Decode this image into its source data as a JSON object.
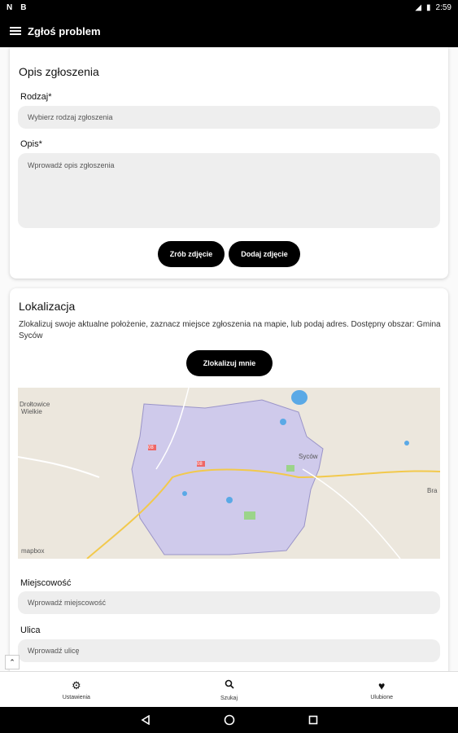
{
  "status_bar": {
    "left_icons": [
      "N",
      "B"
    ],
    "time": "2:59"
  },
  "app_bar": {
    "title": "Zgłoś problem"
  },
  "opis": {
    "title": "Opis zgłoszenia",
    "rodzaj_label": "Rodzaj*",
    "rodzaj_placeholder": "Wybierz rodzaj zgłoszenia",
    "opis_label": "Opis*",
    "opis_placeholder": "Wprowadź opis zgłoszenia",
    "photo_button": "Zrób zdjęcie",
    "add_photo_button": "Dodaj zdjęcie"
  },
  "lokalizacja": {
    "title": "Lokalizacja",
    "description": "Zlokalizuj swoje aktualne położenie, zaznacz miejsce zgłoszenia na mapie, lub podaj adres. Dostępny obszar: Gmina Syców",
    "locate_button": "Zlokalizuj mnie",
    "map": {
      "labels": {
        "town": "Syców",
        "road": "08",
        "road2": "08",
        "place1": "Drołtowice",
        "place1b": "Wielkie",
        "place_right": "Bra",
        "watermark": "mapbox"
      }
    },
    "miejscowosc_label": "Miejscowość",
    "miejscowosc_placeholder": "Wprowadź miejscowość",
    "ulica_label": "Ulica",
    "ulica_placeholder": "Wprowadź ulicę"
  },
  "bottom_nav": [
    {
      "label": "Ustawienia",
      "icon": "gear-icon"
    },
    {
      "label": "Szukaj",
      "icon": "search-icon"
    },
    {
      "label": "Ulubione",
      "icon": "heart-icon"
    }
  ],
  "colors": {
    "bar": "#000000",
    "input_bg": "#eeeeee",
    "region_fill": "#cfcaeb",
    "water": "#5aa9e6"
  }
}
